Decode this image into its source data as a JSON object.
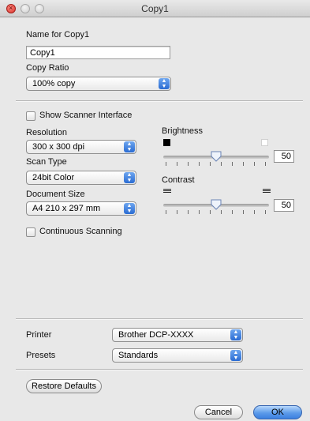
{
  "window": {
    "title": "Copy1"
  },
  "name_section": {
    "label": "Name for Copy1",
    "value": "Copy1"
  },
  "copy_ratio": {
    "label": "Copy Ratio",
    "selected": "100% copy"
  },
  "scanner": {
    "show_interface_label": "Show Scanner Interface",
    "show_interface_checked": false,
    "resolution_label": "Resolution",
    "resolution_selected": "300 x 300 dpi",
    "scan_type_label": "Scan Type",
    "scan_type_selected": "24bit Color",
    "document_size_label": "Document Size",
    "document_size_selected": "A4 210 x 297 mm",
    "continuous_label": "Continuous Scanning",
    "continuous_checked": false
  },
  "brightness": {
    "label": "Brightness",
    "value": "50",
    "min": 0,
    "max": 100
  },
  "contrast": {
    "label": "Contrast",
    "value": "50",
    "min": 0,
    "max": 100
  },
  "printer": {
    "label": "Printer",
    "selected": "Brother DCP-XXXX"
  },
  "presets": {
    "label": "Presets",
    "selected": "Standards"
  },
  "buttons": {
    "restore_defaults": "Restore Defaults",
    "cancel": "Cancel",
    "ok": "OK"
  }
}
